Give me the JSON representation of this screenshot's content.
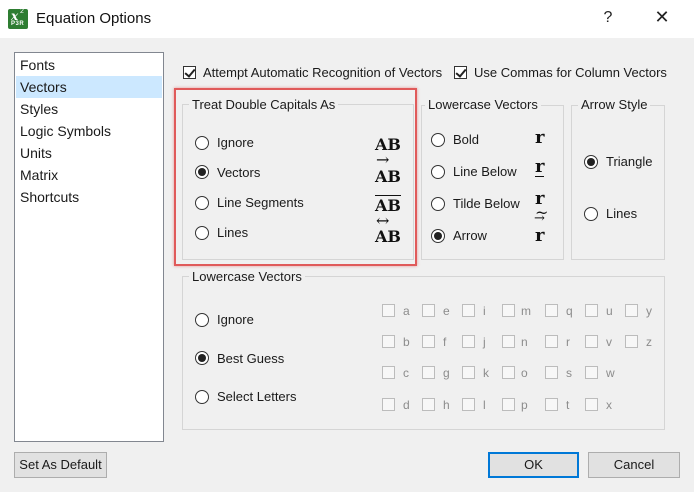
{
  "window": {
    "title": "Equation Options",
    "help_label": "?",
    "close_label": "✕",
    "app_icon": {
      "x_glyph": "x",
      "sup_glyph": "2",
      "product_label": "P3R"
    }
  },
  "nav": {
    "items": [
      {
        "label": "Fonts"
      },
      {
        "label": "Vectors"
      },
      {
        "label": "Styles"
      },
      {
        "label": "Logic Symbols"
      },
      {
        "label": "Units"
      },
      {
        "label": "Matrix"
      },
      {
        "label": "Shortcuts"
      }
    ],
    "selected": "Vectors"
  },
  "top_options": {
    "auto_recognize": {
      "label": "Attempt Automatic Recognition of Vectors",
      "checked": true
    },
    "use_commas": {
      "label": "Use Commas for Column Vectors",
      "checked": true
    }
  },
  "double_capitals": {
    "title": "Treat Double Capitals As",
    "options": [
      {
        "label": "Ignore",
        "notation": "AB"
      },
      {
        "label": "Vectors",
        "notation": "AB"
      },
      {
        "label": "Line Segments",
        "notation": "AB"
      },
      {
        "label": "Lines",
        "notation": "AB"
      }
    ],
    "selected": "Vectors"
  },
  "lowercase_vectors_style": {
    "title": "Lowercase Vectors",
    "options": [
      {
        "label": "Bold",
        "notation": "r"
      },
      {
        "label": "Line Below",
        "notation": "r"
      },
      {
        "label": "Tilde Below",
        "notation": "r"
      },
      {
        "label": "Arrow",
        "notation": "r"
      }
    ],
    "selected": "Arrow",
    "tilde_glyph": "~",
    "arrow_glyph": "→",
    "double_arrow_glyph": "↔"
  },
  "arrow_style": {
    "title": "Arrow Style",
    "options": [
      {
        "label": "Triangle"
      },
      {
        "label": "Lines"
      }
    ],
    "selected": "Triangle"
  },
  "lowercase_letters": {
    "title": "Lowercase Vectors",
    "options": [
      {
        "label": "Ignore"
      },
      {
        "label": "Best Guess"
      },
      {
        "label": "Select Letters"
      }
    ],
    "selected": "Best Guess",
    "letters": [
      [
        "a",
        "e",
        "i",
        "m",
        "q",
        "u",
        "y"
      ],
      [
        "b",
        "f",
        "j",
        "n",
        "r",
        "v",
        "z"
      ],
      [
        "c",
        "g",
        "k",
        "o",
        "s",
        "w"
      ],
      [
        "d",
        "h",
        "l",
        "p",
        "t",
        "x"
      ]
    ]
  },
  "buttons": {
    "set_default": "Set As Default",
    "ok": "OK",
    "cancel": "Cancel"
  },
  "colors": {
    "selection": "#cce8ff",
    "highlight": "#e05a5a",
    "default_button_border": "#0078d7"
  }
}
